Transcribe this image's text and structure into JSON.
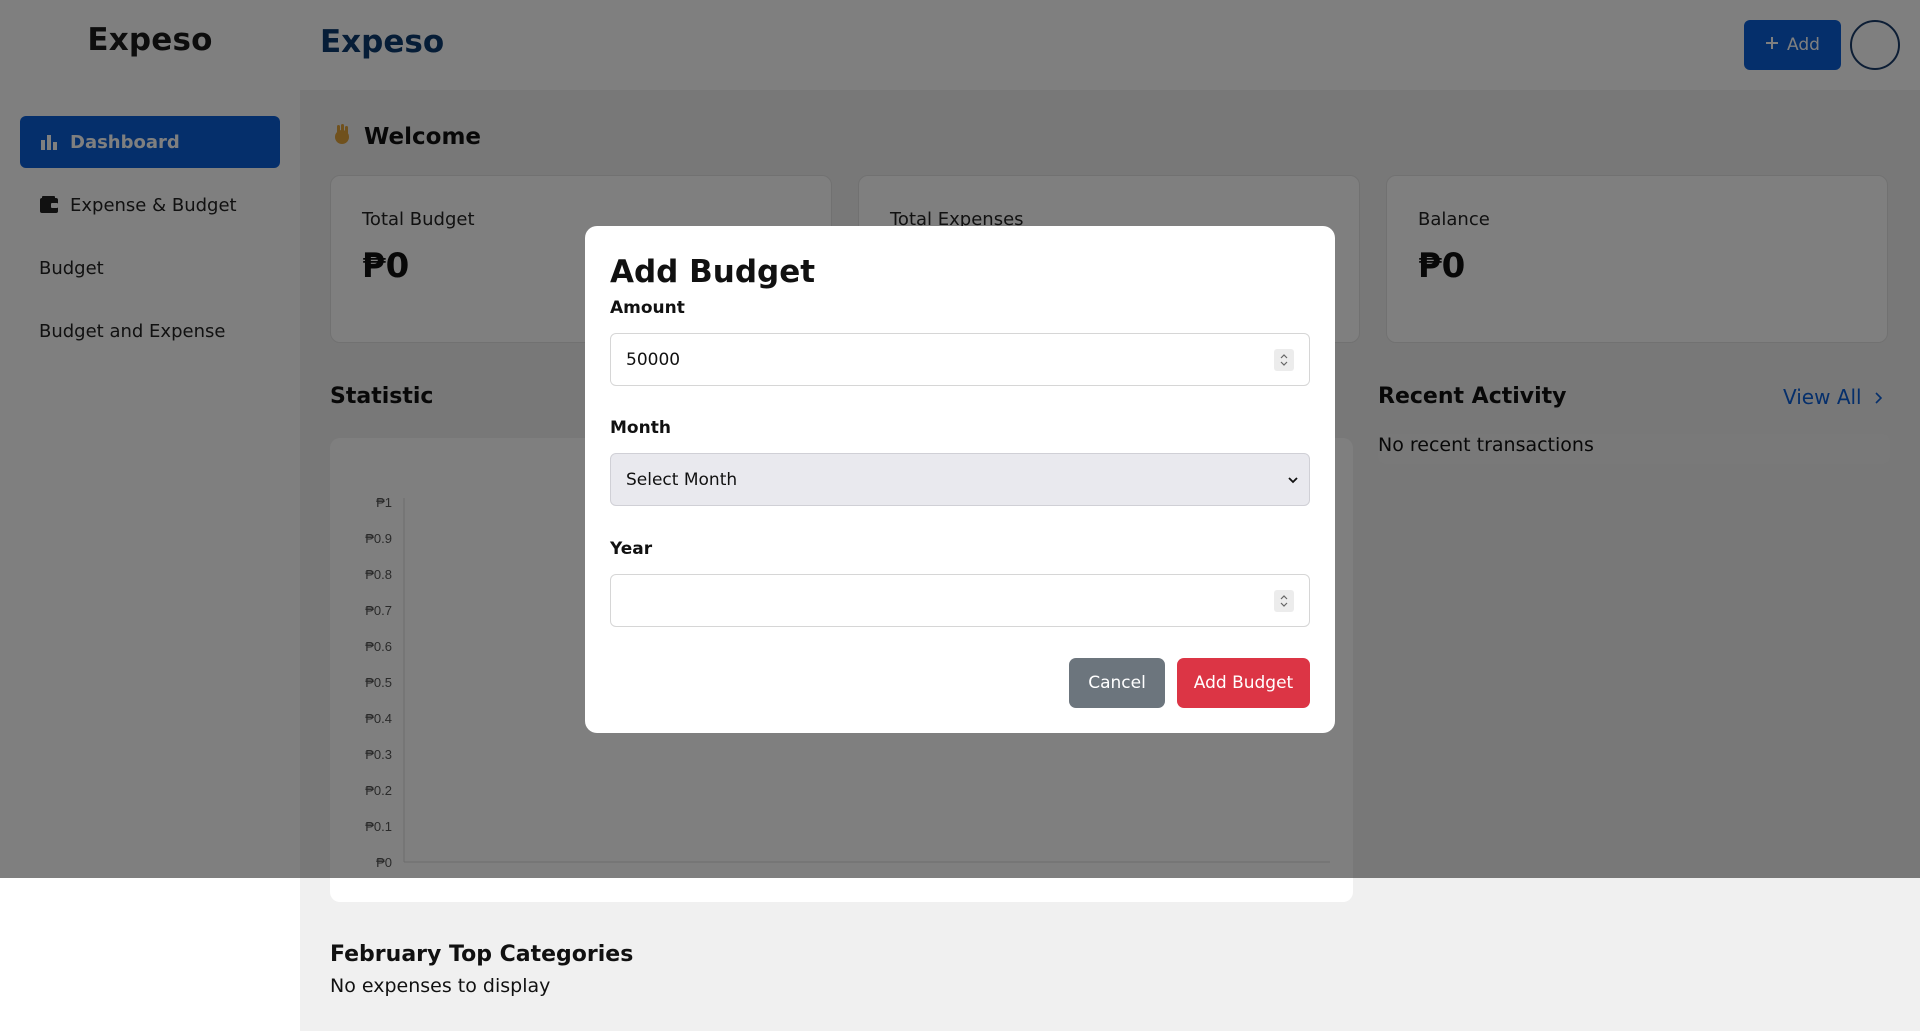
{
  "app": {
    "brand": "Expeso"
  },
  "sidebar": {
    "items": [
      {
        "label": "Dashboard",
        "icon": "bar-chart-icon",
        "active": true
      },
      {
        "label": "Expense & Budget",
        "icon": "wallet-icon",
        "active": false
      },
      {
        "label": "Budget",
        "icon": "",
        "active": false
      },
      {
        "label": "Budget and Expense",
        "icon": "",
        "active": false
      }
    ]
  },
  "header": {
    "brand": "Expeso",
    "add_label": "Add",
    "add_icon": "plus-icon"
  },
  "main": {
    "welcome": "Welcome",
    "welcome_icon": "waving-hand-icon",
    "cards": [
      {
        "label": "Total Budget",
        "value": "₱0"
      },
      {
        "label": "Total Expenses",
        "value": "₱0"
      },
      {
        "label": "Balance",
        "value": "₱0"
      }
    ],
    "statistic_title": "Statistic",
    "recent_title": "Recent Activity",
    "view_all": "View All",
    "recent_empty": "No recent transactions",
    "top_categories_title": "February Top Categories",
    "top_categories_empty": "No expenses to display"
  },
  "chart_data": {
    "type": "bar",
    "categories": [],
    "series": [],
    "title": "",
    "xlabel": "",
    "ylabel": "",
    "ylim": [
      0,
      1
    ],
    "y_ticks": [
      "₱1",
      "₱0.9",
      "₱0.8",
      "₱0.7",
      "₱0.6",
      "₱0.5",
      "₱0.4",
      "₱0.3",
      "₱0.2",
      "₱0.1",
      "₱0"
    ]
  },
  "modal": {
    "title": "Add Budget",
    "amount_label": "Amount",
    "amount_value": "50000",
    "month_label": "Month",
    "month_value": "Select Month",
    "year_label": "Year",
    "year_value": "",
    "cancel_label": "Cancel",
    "submit_label": "Add Budget"
  },
  "colors": {
    "primary": "#0b5ed7",
    "danger": "#dc3545",
    "secondary": "#6c757d",
    "brand_dark": "#0d3b6e"
  }
}
